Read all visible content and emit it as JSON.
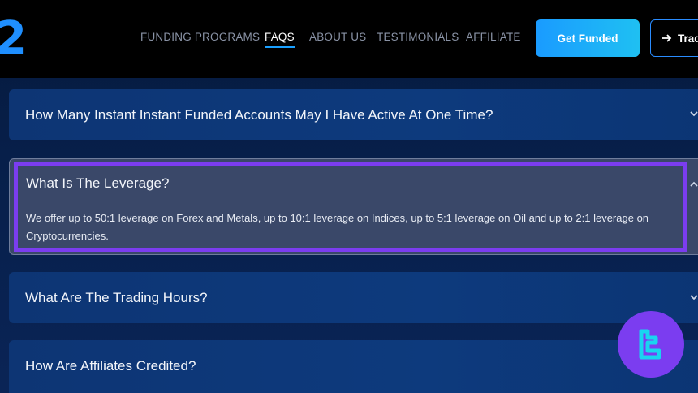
{
  "header": {
    "logo_text": "2",
    "nav": [
      {
        "label": "FUNDING PROGRAMS"
      },
      {
        "label": "FAQS",
        "active": true
      },
      {
        "label": "ABOUT US"
      },
      {
        "label": "TESTIMONIALS"
      },
      {
        "label": "AFFILIATE"
      }
    ],
    "get_funded_label": "Get Funded",
    "trade_label": "Trad"
  },
  "faqs": [
    {
      "question": "How Many Instant Instant Funded Accounts May I Have Active At One Time?"
    },
    {
      "question": "What Is The Leverage?",
      "expanded": true,
      "answer": "We offer up to 50:1 leverage on Forex and Metals, up to 10:1 leverage on Indices, up to 5:1 leverage on Oil and up to 2:1 leverage on Cryptocurrencies."
    },
    {
      "question": "What Are The Trading Hours?"
    },
    {
      "question": "How Are Affiliates Credited?"
    }
  ],
  "icons": {
    "chevron": "chevron-down-icon",
    "arrow": "arrow-right-icon",
    "badge": "tradingfinder-logo-icon"
  },
  "colors": {
    "accent": "#1a9bff",
    "highlight": "#7b3df0",
    "badge_glyph": "#19d4f0"
  }
}
